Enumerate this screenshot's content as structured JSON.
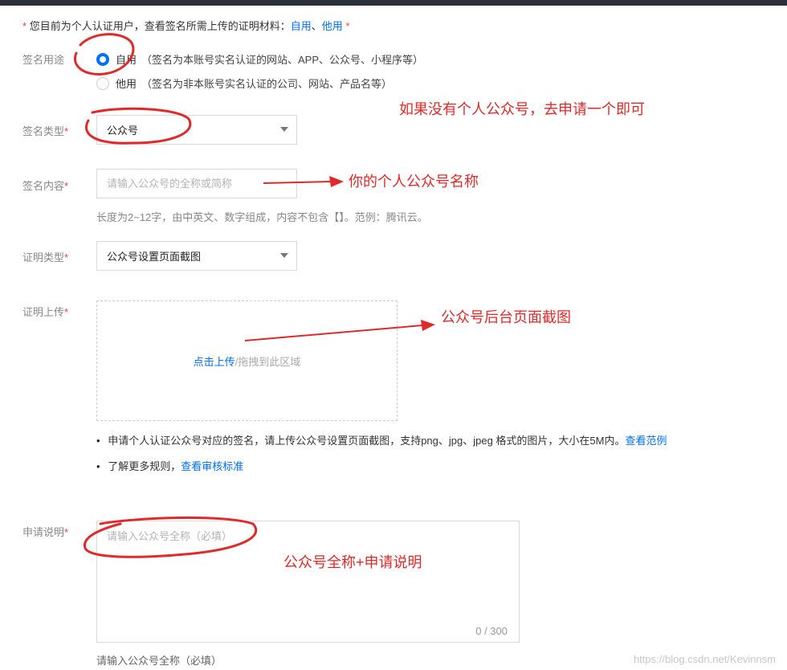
{
  "notice": {
    "star": "*",
    "text": "您目前为个人认证用户，查看签名所需上传的证明材料：",
    "self_link": "自用",
    "sep": "、",
    "other_link": "他用",
    "star_end": " *"
  },
  "purpose": {
    "label": "签名用途",
    "options": [
      {
        "title": "自用",
        "hint": "（签名为本账号实名认证的网站、APP、公众号、小程序等）",
        "checked": true
      },
      {
        "title": "他用",
        "hint": "（签名为非本账号实名认证的公司、网站、产品名等）",
        "checked": false
      }
    ]
  },
  "sign_type": {
    "label": "签名类型",
    "star": "*",
    "value": "公众号"
  },
  "sign_content": {
    "label": "签名内容",
    "star": "*",
    "placeholder": "请输入公众号的全称或简称",
    "tip": "长度为2~12字，由中英文、数字组成，内容不包含【】。范例：腾讯云。"
  },
  "proof_type": {
    "label": "证明类型",
    "star": "*",
    "value": "公众号设置页面截图"
  },
  "proof_upload": {
    "label": "证明上传",
    "star": "*",
    "click_text": "点击上传",
    "drag_text": "/拖拽到此区域",
    "bullets": [
      {
        "text": "申请个人认证公众号对应的签名，请上传公众号设置页面截图，支持png、jpg、jpeg 格式的图片，大小在5M内。",
        "link": "查看范例"
      },
      {
        "text": "了解更多规则，",
        "link": "查看审核标准"
      }
    ]
  },
  "description": {
    "label": "申请说明",
    "star": "*",
    "placeholder": "请输入公众号全称（必填）",
    "counter": "0 / 300",
    "tip": "请输入公众号全称（必填）"
  },
  "annotations": {
    "a1": "如果没有个人公众号，去申请一个即可",
    "a2": "你的个人公众号名称",
    "a3": "公众号后台页面截图",
    "a4": "公众号全称+申请说明"
  },
  "watermark": "https://blog.csdn.net/Kevinnsm",
  "colors": {
    "accent": "#006eff",
    "required": "#e54545",
    "annotation": "#e02a2a"
  }
}
